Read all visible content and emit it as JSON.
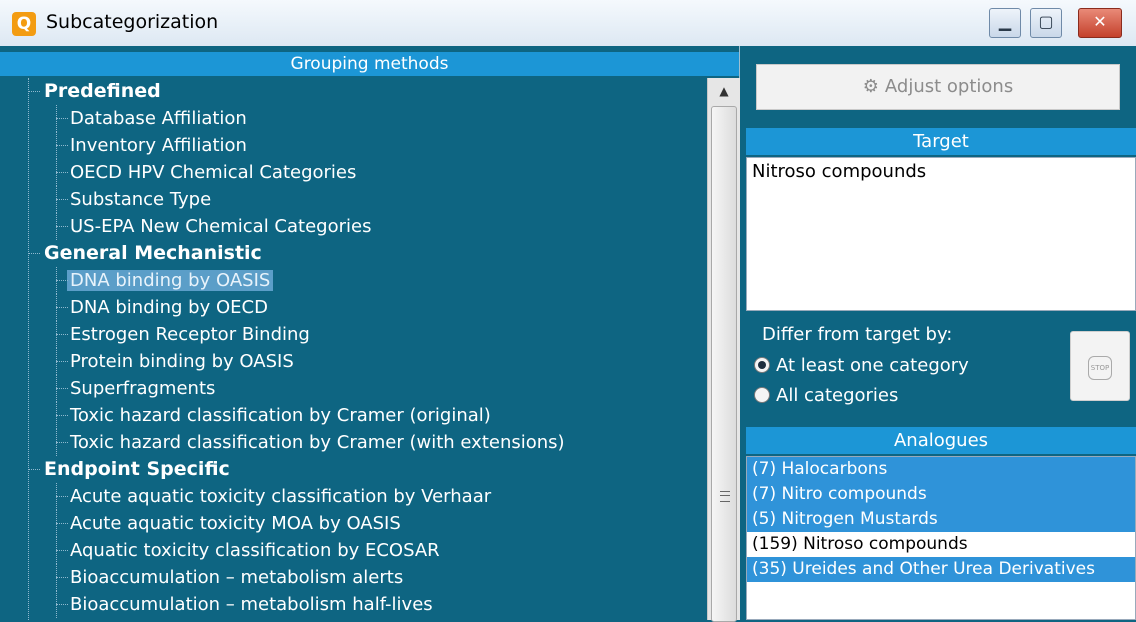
{
  "window": {
    "title": "Subcategorization",
    "icon_letter": "Q",
    "controls": {
      "minimize": "▁",
      "maximize": "▢",
      "close": "✕"
    }
  },
  "left": {
    "header": "Grouping methods",
    "groups": [
      {
        "label": "Predefined",
        "items": [
          "Database Affiliation",
          "Inventory Affiliation",
          "OECD HPV Chemical Categories",
          "Substance Type",
          "US-EPA New Chemical Categories"
        ]
      },
      {
        "label": "General Mechanistic",
        "items": [
          "DNA binding by OASIS",
          "DNA binding by OECD",
          "Estrogen Receptor Binding",
          "Protein binding by OASIS",
          "Superfragments",
          "Toxic hazard classification by Cramer (original)",
          "Toxic hazard classification by Cramer (with extensions)"
        ]
      },
      {
        "label": "Endpoint Specific",
        "items": [
          "Acute aquatic toxicity classification by Verhaar",
          "Acute aquatic toxicity MOA by OASIS",
          "Aquatic toxicity classification by ECOSAR",
          "Bioaccumulation – metabolism alerts",
          "Bioaccumulation – metabolism half-lives"
        ]
      }
    ],
    "selected_item": "DNA binding by OASIS"
  },
  "right": {
    "adjust_button": "Adjust options",
    "adjust_icon": "settings-icon",
    "target_header": "Target",
    "target_value": "Nitroso compounds",
    "differ_label": "Differ from target by:",
    "radio_options": [
      "At least one category",
      "All categories"
    ],
    "radio_selected": "At least one category",
    "stop_label": "STOP",
    "analogues_header": "Analogues",
    "analogues": [
      {
        "label": "(7) Halocarbons",
        "selected": true
      },
      {
        "label": "(7) Nitro compounds",
        "selected": true
      },
      {
        "label": "(5) Nitrogen Mustards",
        "selected": true
      },
      {
        "label": "(159) Nitroso compounds",
        "selected": false
      },
      {
        "label": "(35) Ureides and Other Urea Derivatives",
        "selected": true
      }
    ]
  },
  "colors": {
    "panel_bg": "#0e6582",
    "header_bg": "#1c96d6",
    "selection": "#2f93d9"
  }
}
